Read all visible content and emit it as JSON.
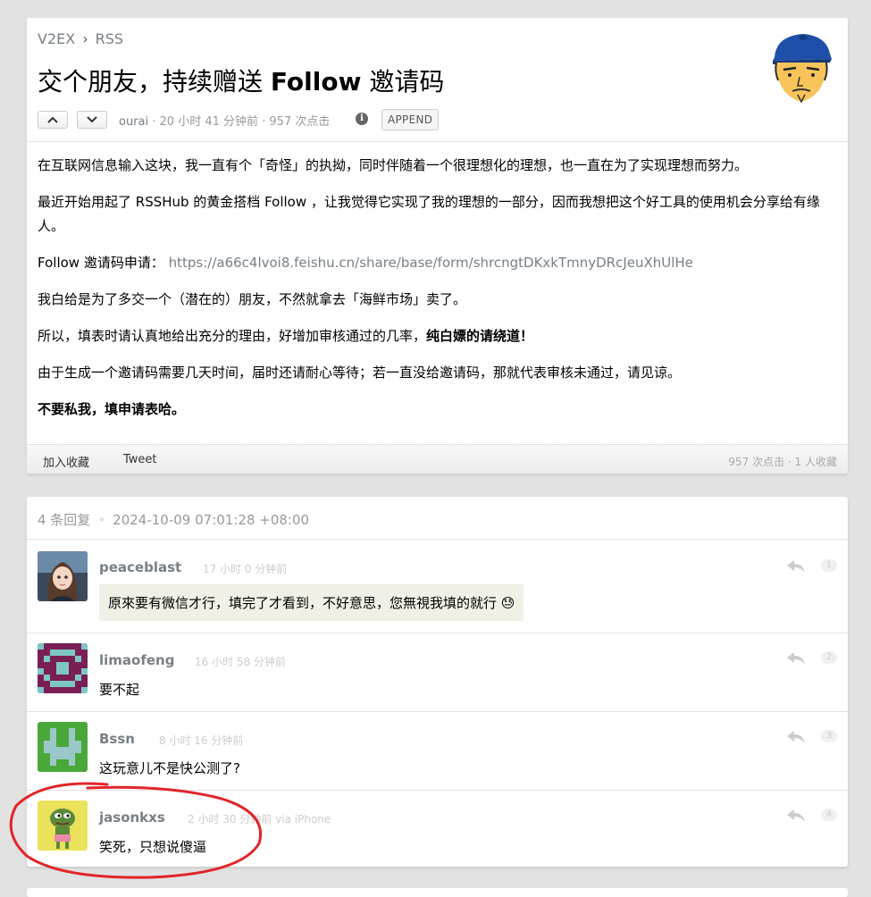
{
  "breadcrumb": {
    "site": "V2EX",
    "sep": "›",
    "node": "RSS"
  },
  "topic": {
    "title_pre": "交个朋友，持续赠送 ",
    "title_bold": "Follow",
    "title_post": " 邀请码",
    "author": "ourai",
    "meta_rest": " · 20 小时 41 分钟前 · 957 次点击",
    "info_icon": "i",
    "append_label": "APPEND",
    "paragraphs": [
      "在互联网信息输入这块，我一直有个「奇怪」的执拗，同时伴随着一个很理想化的理想，也一直在为了实现理想而努力。",
      "最近开始用起了 RSSHub 的黄金搭档 Follow ，让我觉得它实现了我的理想的一部分，因而我想把这个好工具的使用机会分享给有缘人。",
      "我白给是为了多交一个（潜在的）朋友，不然就拿去「海鲜市场」卖了。",
      "由于生成一个邀请码需要几天时间，届时还请耐心等待；若一直没给邀请码，那就代表审核未通过，请见谅。"
    ],
    "link_label": "Follow 邀请码申请：",
    "link_url": "https://a66c4lvoi8.feishu.cn/share/base/form/shrcngtDKxkTmnyDRcJeuXhUlHe",
    "p5_plain": "所以，填表时请认真地给出充分的理由，好增加审核通过的几率，",
    "p5_bold": "纯白嫖的请绕道！",
    "p7_bold": "不要私我，填申请表哈。",
    "footer_fav": "加入收藏",
    "footer_tweet": "Tweet",
    "footer_stats": "957 次点击 · 1 人收藏"
  },
  "replies_header": {
    "count": "4 条回复",
    "dot": "•",
    "date": "2024-10-09 07:01:28 +08:00"
  },
  "replies": [
    {
      "name": "peaceblast",
      "time": "17 小时 0 分钟前",
      "text": "原來要有微信才行，填完了才看到，不好意思，您無視我填的就行 😓",
      "num": "1"
    },
    {
      "name": "limaofeng",
      "time": "16 小时 58 分钟前",
      "text": "要不起",
      "num": "2"
    },
    {
      "name": "Bssn",
      "time": "8 小时 16 分钟前",
      "text": "这玩意儿不是快公测了?",
      "num": "3"
    },
    {
      "name": "jasonkxs",
      "time": "2 小时 30 分钟前 via iPhone",
      "text": "笑死，只想说傻逼",
      "num": "4"
    }
  ],
  "colors": {
    "link": "#778087",
    "annotation": "#e0262a",
    "background": "#e2e2e2"
  }
}
